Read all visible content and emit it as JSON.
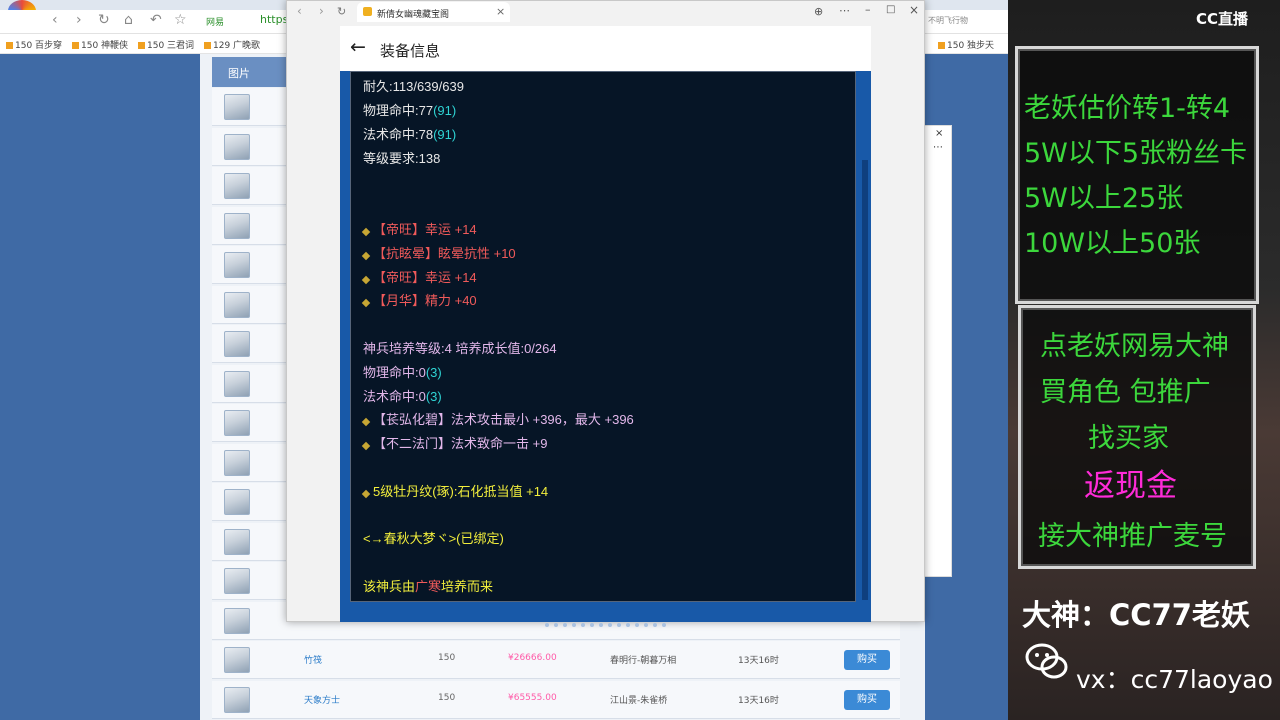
{
  "background_browser": {
    "address_partial": "https",
    "address_chip": "网易",
    "address_right": "不明飞行物",
    "bookmarks": [
      "150 百步穿",
      "150 神鞭侠",
      "150 三君词",
      "129 广晚歌",
      "150 独步天"
    ]
  },
  "table": {
    "header_first": "图片",
    "rows": [
      {
        "name": "",
        "level": "",
        "price": "",
        "server": "",
        "time": "",
        "buy": ""
      },
      {
        "name": "",
        "level": "",
        "price": "",
        "server": "",
        "time": "",
        "buy": ""
      },
      {
        "name": "",
        "level": "",
        "price": "",
        "server": "",
        "time": "",
        "buy": ""
      },
      {
        "name": "",
        "level": "",
        "price": "",
        "server": "",
        "time": "",
        "buy": ""
      },
      {
        "name": "",
        "level": "",
        "price": "",
        "server": "",
        "time": "",
        "buy": ""
      },
      {
        "name": "",
        "level": "",
        "price": "",
        "server": "",
        "time": "",
        "buy": ""
      },
      {
        "name": "",
        "level": "",
        "price": "",
        "server": "",
        "time": "",
        "buy": ""
      },
      {
        "name": "",
        "level": "",
        "price": "",
        "server": "",
        "time": "",
        "buy": ""
      },
      {
        "name": "",
        "level": "",
        "price": "",
        "server": "",
        "time": "",
        "buy": ""
      },
      {
        "name": "",
        "level": "",
        "price": "",
        "server": "",
        "time": "",
        "buy": ""
      },
      {
        "name": "",
        "level": "",
        "price": "",
        "server": "",
        "time": "",
        "buy": ""
      },
      {
        "name": "",
        "level": "",
        "price": "",
        "server": "",
        "time": "",
        "buy": ""
      },
      {
        "name": "",
        "level": "",
        "price": "",
        "server": "",
        "time": "",
        "buy": ""
      },
      {
        "name": "",
        "level": "",
        "price": "",
        "server": "",
        "time": "",
        "buy": ""
      },
      {
        "name": "竹筏",
        "level": "150",
        "price": "¥26666.00",
        "server": "春明行-朝暮万相",
        "time": "13天16时",
        "buy": "购买"
      },
      {
        "name": "天象方士",
        "level": "150",
        "price": "¥65555.00",
        "server": "江山景-朱雀桥",
        "time": "13天16时",
        "buy": "购买"
      }
    ]
  },
  "popup": {
    "tab_title": "新倩女幽魂藏宝阁",
    "header_title": "装备信息",
    "stats": {
      "durability": "耐久:113/639/639",
      "phys_hit_label": "物理命中:77",
      "phys_hit_bonus": "(91)",
      "mag_hit_label": "法术命中:78",
      "mag_hit_bonus": "(91)",
      "level_req": "等级要求:138"
    },
    "red_attrs": [
      "【帝旺】幸运 +14",
      "【抗眩晕】眩晕抗性 +10",
      "【帝旺】幸运 +14",
      "【月华】精力 +40"
    ],
    "forge": {
      "line": "神兵培养等级:4 培养成长值:0/264",
      "phys_label": "物理命中:0",
      "phys_bonus": "(3)",
      "mag_label": "法术命中:0",
      "mag_bonus": "(3)"
    },
    "purple_attrs": [
      "【苌弘化碧】法术攻击最小 +396，最大 +396",
      "【不二法门】法术致命一击 +9"
    ],
    "yellow_attr": "5级牡丹纹(琢):石化抵当值 +14",
    "set_line": "<→春秋大梦ヾ>(已绑定)",
    "source_prefix": "该神兵由",
    "source_name": "广寒",
    "source_suffix": "培养而来"
  },
  "overlay": {
    "logo": "CC直播",
    "box1": [
      "老妖估价转1-转4",
      "5W以下5张粉丝卡",
      "5W以上25张",
      "10W以上50张"
    ],
    "box2": [
      "点老妖网易大神",
      "買角色 包推广",
      "找买家",
      "返现金",
      "接大神推广麦号"
    ],
    "signature": "大神：CC77老妖",
    "wechat": "vx：cc77laoyao"
  },
  "colors": {
    "panel_bg": "#061526",
    "popup_blue": "#1859a8",
    "green": "#3cd73c",
    "magenta": "#ff2bd8"
  }
}
